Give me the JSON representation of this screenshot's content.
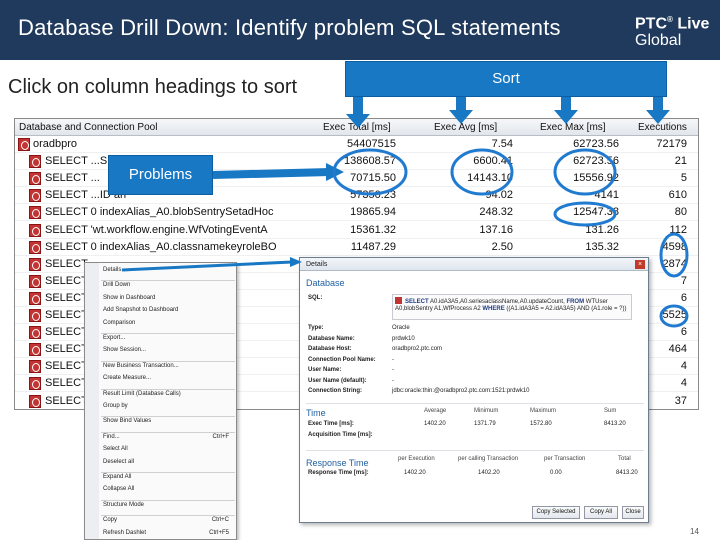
{
  "header": {
    "title": "Database Drill Down: Identify problem SQL statements",
    "logo_line1": "PTC",
    "logo_reg": "®",
    "logo_line1b": "Live",
    "logo_line2": "Global"
  },
  "subtitle": "Click on column headings to sort",
  "callouts": {
    "sort": "Sort",
    "problems": "Problems"
  },
  "colors": {
    "header_bg": "#1f3a5c",
    "callout_blue": "#1878c4",
    "circle_blue": "#1f7ad0",
    "db_icon_red": "#c23333"
  },
  "grid": {
    "columns": [
      "Database and Connection Pool",
      "Exec Total [ms]",
      "Exec Avg [ms]",
      "Exec Max [ms]",
      "Executions"
    ],
    "rows": [
      {
        "name": "oradbpro",
        "total": "54407515",
        "avg": "7.54",
        "max": "62723.56",
        "exec": "72179"
      },
      {
        "name": "SELECT ...S (SELEC",
        "total": "138608.57",
        "avg": "6600.41",
        "max": "62723.56",
        "exec": "21"
      },
      {
        "name": "SELECT ...",
        "total": "70715.50",
        "avg": "14143.10",
        "max": "15556.92",
        "exec": "5"
      },
      {
        "name": "SELECT ...ID an",
        "total": "57350.23",
        "avg": "94.02",
        "max": "4141",
        "exec": "610"
      },
      {
        "name": "SELECT 0 indexAlias_A0.blobSentrySetadHoc",
        "total": "19865.94",
        "avg": "248.32",
        "max": "12547.38",
        "exec": "80"
      },
      {
        "name": "SELECT 'wt.workflow.engine.WfVotingEventA",
        "total": "15361.32",
        "avg": "137.16",
        "max": "131.26",
        "exec": "112"
      },
      {
        "name": "SELECT 0 indexAlias_A0.classnamekeyroleBO",
        "total": "11487.29",
        "avg": "2.50",
        "max": "135.32",
        "exec": "4598"
      },
      {
        "name": "SELECT ...",
        "total": "",
        "avg": "",
        "max": "",
        "exec": "2874"
      },
      {
        "name": "SELECT ...",
        "total": "",
        "avg": "",
        "max": "",
        "exec": "7"
      },
      {
        "name": "SELECT ...ableBObj",
        "total": "",
        "avg": "",
        "max": "",
        "exec": "6"
      },
      {
        "name": "SELECT ...inistrativ",
        "total": "",
        "avg": "",
        "max": "",
        "exec": "5525"
      },
      {
        "name": "SELECT ...ableBObj",
        "total": "",
        "avg": "",
        "max": "",
        "exec": "6"
      },
      {
        "name": "SELECT ...eA0.eush",
        "total": "",
        "avg": "",
        "max": "",
        "exec": "464"
      },
      {
        "name": "SELECT ...ativeLoc",
        "total": "",
        "avg": "",
        "max": "",
        "exec": "4"
      },
      {
        "name": "SELECT ...eA2A2,",
        "total": "",
        "avg": "",
        "max": "",
        "exec": "4"
      },
      {
        "name": "SELECT ...business",
        "total": "",
        "avg": "",
        "max": "",
        "exec": "37"
      }
    ]
  },
  "context_menu": {
    "items": [
      {
        "label": "Details...",
        "shortcut": ""
      },
      {
        "label": "Drill Down",
        "shortcut": ""
      },
      {
        "label": "Show in Dashboard",
        "shortcut": ""
      },
      {
        "label": "Add Snapshot to Dashboard",
        "shortcut": ""
      },
      {
        "label": "Comparison",
        "shortcut": ""
      },
      {
        "label": "Export...",
        "shortcut": ""
      },
      {
        "label": "Show Session...",
        "shortcut": ""
      },
      {
        "label": "New Business Transaction...",
        "shortcut": ""
      },
      {
        "label": "Create Measure...",
        "shortcut": ""
      },
      {
        "label": "Result Limit (Database Calls)",
        "shortcut": ""
      },
      {
        "label": "Group by",
        "shortcut": ""
      },
      {
        "label": "Show Bind Values",
        "shortcut": ""
      },
      {
        "label": "Find...",
        "shortcut": "Ctrl+F"
      },
      {
        "label": "Select All",
        "shortcut": ""
      },
      {
        "label": "Deselect all",
        "shortcut": ""
      },
      {
        "label": "Expand All",
        "shortcut": ""
      },
      {
        "label": "Collapse All",
        "shortcut": ""
      },
      {
        "label": "Structure Mode",
        "shortcut": ""
      },
      {
        "label": "Copy",
        "shortcut": "Ctrl+C"
      },
      {
        "label": "Refresh Dashlet",
        "shortcut": "Ctrl+F5"
      }
    ]
  },
  "details": {
    "title": "Details",
    "database_section": "Database",
    "sql_label": "SQL:",
    "sql_text_kw1": "SELECT",
    "sql_text_1": "A0.idA3A5,A0.seriesaclassName,A0.updateCount,",
    "sql_text_kw2": "FROM",
    "sql_text_2": "WTUser A0,blobSentry A1,WfProcess A2",
    "sql_text_kw3": "WHERE",
    "sql_text_3": "((A1.idA3A5 = A2.idA3A5) AND (A1.role = ?))",
    "fields": [
      {
        "key": "Type:",
        "value": "Oracle"
      },
      {
        "key": "Database Name:",
        "value": "prdwk10"
      },
      {
        "key": "Database Host:",
        "value": "oradbpro2.ptc.com"
      },
      {
        "key": "Connection Pool Name:",
        "value": "-"
      },
      {
        "key": "User Name:",
        "value": "-"
      },
      {
        "key": "User Name (default):",
        "value": "-"
      },
      {
        "key": "Connection String:",
        "value": "jdbc:oracle:thin:@oradbpro2.ptc.com:1521:prdwk10"
      }
    ],
    "time_section": "Time",
    "time_headers": [
      "Average",
      "Minimum",
      "Maximum",
      "Sum"
    ],
    "time_rows": [
      {
        "key": "Exec Time [ms]:",
        "values": [
          "1402.20",
          "1371.79",
          "1572.80",
          "8413.20"
        ]
      },
      {
        "key": "Acquisition Time [ms]:",
        "values": [
          "",
          "",
          "",
          ""
        ]
      }
    ],
    "response_section": "Response Time",
    "response_headers": [
      "per Execution",
      "per calling Transaction",
      "per Transaction",
      "Total"
    ],
    "response_rows": [
      {
        "key": "Response Time [ms]:",
        "values": [
          "1402.20",
          "1402.20",
          "0.00",
          "8413.20"
        ]
      }
    ],
    "buttons": {
      "copy_selected": "Copy Selected",
      "copy_all": "Copy All",
      "close": "Close"
    }
  },
  "page_number": "14"
}
